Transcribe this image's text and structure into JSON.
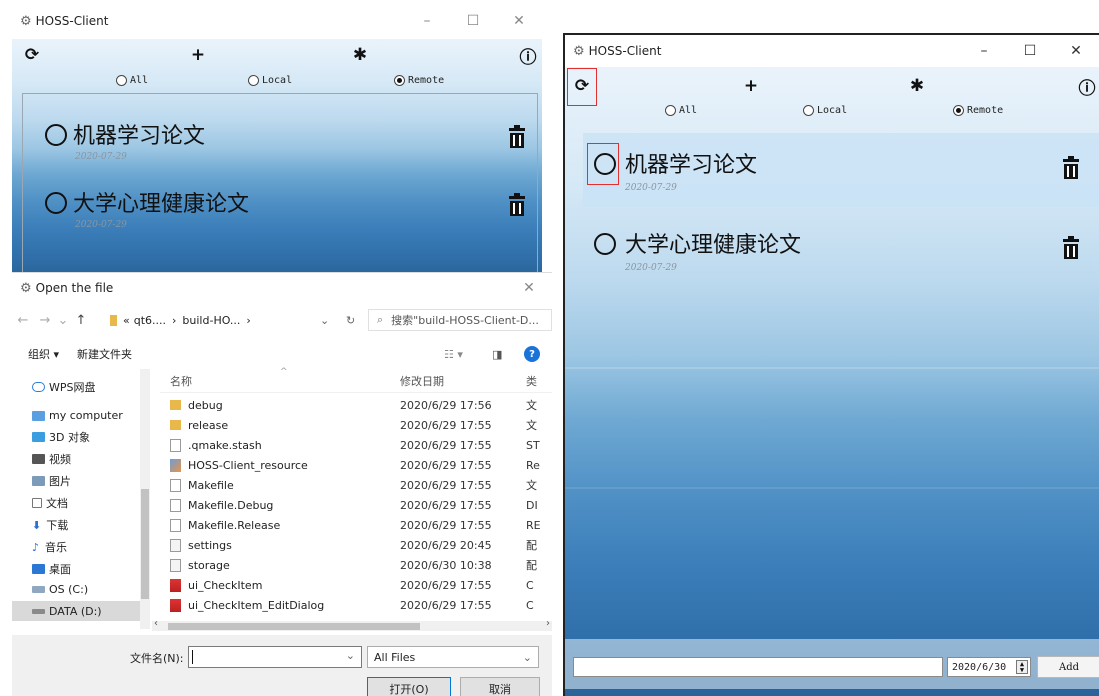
{
  "left_window": {
    "title": "HOSS-Client",
    "filters": {
      "all": "All",
      "local": "Local",
      "remote": "Remote"
    },
    "items": [
      {
        "title": "机器学习论文",
        "date": "2020-07-29"
      },
      {
        "title": "大学心理健康论文",
        "date": "2020-07-29"
      }
    ]
  },
  "dialog": {
    "title": "Open the file",
    "breadcrumb": [
      "«",
      "qt6....",
      "›",
      "build-HO...",
      "›"
    ],
    "search_placeholder": "搜索\"build-HOSS-Client-D...",
    "commands": {
      "organize": "组织 ▾",
      "new_folder": "新建文件夹"
    },
    "nav_items": [
      "WPS网盘",
      "my computer",
      "3D 对象",
      "视频",
      "图片",
      "文档",
      "下载",
      "音乐",
      "桌面",
      "OS (C:)",
      "DATA (D:)"
    ],
    "columns": {
      "name": "名称",
      "date": "修改日期",
      "type": "类"
    },
    "files": [
      {
        "name": "debug",
        "date": "2020/6/29 17:56",
        "type": "文",
        "icon": "folder"
      },
      {
        "name": "release",
        "date": "2020/6/29 17:55",
        "type": "文",
        "icon": "folder"
      },
      {
        "name": ".qmake.stash",
        "date": "2020/6/29 17:55",
        "type": "ST",
        "icon": "doc"
      },
      {
        "name": "HOSS-Client_resource",
        "date": "2020/6/29 17:55",
        "type": "Re",
        "icon": "res"
      },
      {
        "name": "Makefile",
        "date": "2020/6/29 17:55",
        "type": "文",
        "icon": "doc"
      },
      {
        "name": "Makefile.Debug",
        "date": "2020/6/29 17:55",
        "type": "DI",
        "icon": "doc"
      },
      {
        "name": "Makefile.Release",
        "date": "2020/6/29 17:55",
        "type": "RE",
        "icon": "doc"
      },
      {
        "name": "settings",
        "date": "2020/6/29 20:45",
        "type": "配",
        "icon": "set"
      },
      {
        "name": "storage",
        "date": "2020/6/30 10:38",
        "type": "配",
        "icon": "set"
      },
      {
        "name": "ui_CheckItem",
        "date": "2020/6/29 17:55",
        "type": "C",
        "icon": "ui"
      },
      {
        "name": "ui_CheckItem_EditDialog",
        "date": "2020/6/29 17:55",
        "type": "C",
        "icon": "ui"
      }
    ],
    "filename_label": "文件名(N):",
    "filename_value": "",
    "filter_value": "All Files",
    "open_button": "打开(O)",
    "cancel_button": "取消"
  },
  "right_window": {
    "title": "HOSS-Client",
    "filters": {
      "all": "All",
      "local": "Local",
      "remote": "Remote"
    },
    "items": [
      {
        "title": "机器学习论文",
        "date": "2020-07-29"
      },
      {
        "title": "大学心理健康论文",
        "date": "2020-07-29"
      }
    ],
    "date_value": "2020/6/30",
    "add_button": "Add"
  }
}
